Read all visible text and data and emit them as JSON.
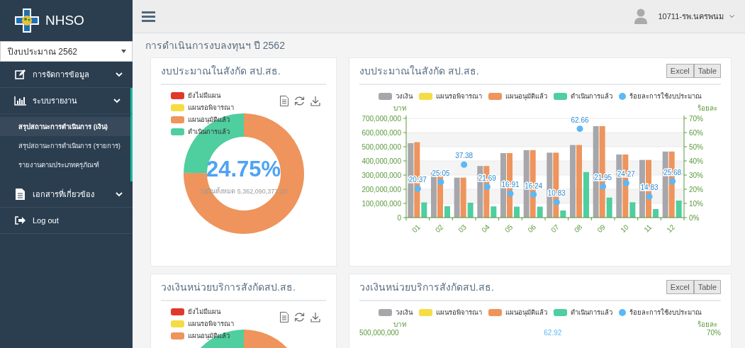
{
  "sidebar": {
    "logo_text": "NHSO",
    "year_select": {
      "value": "ปีงบประมาณ 2562"
    },
    "menu": [
      {
        "kind": "group",
        "label": "การจัดการข้อมูล",
        "expanded": false
      },
      {
        "kind": "group",
        "label": "ระบบรายงาน",
        "expanded": true,
        "children": [
          {
            "label": "สรุปสถานะการดำเนินการ (เงิน)",
            "selected": true
          },
          {
            "label": "สรุปสถานะการดำเนินการ (รายการ)",
            "selected": false
          },
          {
            "label": "รายงานตามประเภทครุภัณฑ์",
            "selected": false
          }
        ]
      },
      {
        "kind": "group",
        "label": "เอกสารที่เกี่ยวข้อง",
        "expanded": false
      },
      {
        "kind": "link",
        "label": "Log out"
      }
    ]
  },
  "topbar": {
    "user": "10711-รพ.นครพนม"
  },
  "page_title": "การดำเนินการงบลงทุนฯ ปี 2562",
  "panels": [
    {
      "kind": "donut",
      "title": "งบประมาณในสังกัด สป.สธ.",
      "center_value": "24.75%",
      "total_text": "วงเงินทั้งหมด 5,362,090,377.10",
      "legend": [
        {
          "color": "#e0392b"
        },
        {
          "color": "#f5dc45"
        },
        {
          "color": "#ee945c"
        },
        {
          "color": "#4fcea0"
        }
      ],
      "chart_data": {
        "type": "donut",
        "categories": [
          "ยังไม่มีแผน",
          "แผนรอพิจารณา",
          "แผนอนุมัติแล้ว",
          "ดำเนินการแล้ว"
        ],
        "values": [
          0,
          0,
          75.25,
          24.75
        ]
      }
    },
    {
      "kind": "bar",
      "title": "งบประมาณในสังกัด สป.สธ.",
      "buttons": [
        "Excel",
        "Table"
      ],
      "y_unit": "บาท",
      "y2_unit": "ร้อยละ",
      "right_ticks": [
        "70%",
        "60%",
        "50%",
        "40%",
        "30%",
        "20%",
        "10%",
        "0%"
      ],
      "point_labels": [
        "20.37",
        "25.05",
        "37.38",
        "21.69",
        "16.91",
        "16.24",
        "10.83",
        "62.66",
        "21.95",
        "24.27",
        "14.83",
        "25.68"
      ],
      "chart_data": {
        "type": "bar",
        "categories": [
          "01",
          "02",
          "03",
          "04",
          "05",
          "06",
          "07",
          "08",
          "09",
          "10",
          "11",
          "12"
        ],
        "ylim": [
          0,
          700000000
        ],
        "grid": true,
        "yticks": [
          {
            "value": 0,
            "label": "0"
          },
          {
            "value": 100000000,
            "label": "100,000,000"
          },
          {
            "value": 200000000,
            "label": "200,000,000"
          },
          {
            "value": 300000000,
            "label": "300,000,000"
          },
          {
            "value": 400000000,
            "label": "400,000,000"
          },
          {
            "value": 500000000,
            "label": "500,000,000"
          },
          {
            "value": 600000000,
            "label": "600,000,000"
          },
          {
            "value": 700000000,
            "label": "700,000,000"
          }
        ],
        "series": [
          {
            "name": "วงเงิน",
            "color": "#a7a7ab",
            "values": [
              525000000,
              322000000,
              282000000,
              364000000,
              455000000,
              476000000,
              458000000,
              512000000,
              645000000,
              445000000,
              407000000,
              466000000
            ]
          },
          {
            "name": "แผนรอพิจารณา",
            "color": "#f5dc45",
            "values": [
              0,
              0,
              0,
              0,
              0,
              0,
              0,
              0,
              0,
              0,
              0,
              0
            ]
          },
          {
            "name": "แผนอนุมัติแล้ว",
            "color": "#ee945c",
            "values": [
              532000000,
              322000000,
              282000000,
              364000000,
              455000000,
              476000000,
              458000000,
              512000000,
              645000000,
              445000000,
              407000000,
              466000000
            ]
          },
          {
            "name": "ดำเนินการแล้ว",
            "color": "#4fcea0",
            "values": [
              107000000,
              80000000,
              105000000,
              79000000,
              77000000,
              77000000,
              50000000,
              321000000,
              141000000,
              108000000,
              60000000,
              120000000
            ]
          },
          {
            "name": "ร้อยละการใช้งบประมาณ",
            "color": "#5cb8f6",
            "values": [
              20.37,
              25.05,
              37.38,
              21.69,
              16.91,
              16.24,
              10.83,
              62.66,
              21.95,
              24.27,
              14.83,
              25.68
            ]
          }
        ]
      }
    },
    {
      "kind": "donut",
      "title": "วงเงินหน่วยบริการสังกัดสป.สธ.",
      "legend": [
        {
          "label": "ยังไม่มีแผน",
          "color": "#e0392b"
        },
        {
          "label": "แผนรอพิจารณา",
          "color": "#f5dc45"
        },
        {
          "label": "แผนอนุมัติแล้ว",
          "color": "#ee945c"
        }
      ]
    },
    {
      "kind": "bar",
      "title": "วงเงินหน่วยบริการสังกัดสป.สธ.",
      "buttons": [
        "Excel",
        "Table"
      ],
      "y_unit": "บาท",
      "y2_unit": "ร้อยละ",
      "legend": [
        {
          "label": "วงเงิน",
          "color": "#a7a7ab",
          "kind": "bar"
        },
        {
          "label": "แผนรอพิจารณา",
          "color": "#f5dc45",
          "kind": "bar"
        },
        {
          "label": "แผนอนุมัติแล้ว",
          "color": "#ee945c",
          "kind": "bar"
        },
        {
          "label": "ดำเนินการแล้ว",
          "color": "#4fcea0",
          "kind": "bar"
        },
        {
          "label": "ร้อยละการใช้งบประมาณ",
          "color": "#5cb8f6",
          "kind": "dot"
        }
      ],
      "top_tick": "500,000,000",
      "top_right_tick": "70%",
      "top_data_label": "62.92"
    }
  ]
}
